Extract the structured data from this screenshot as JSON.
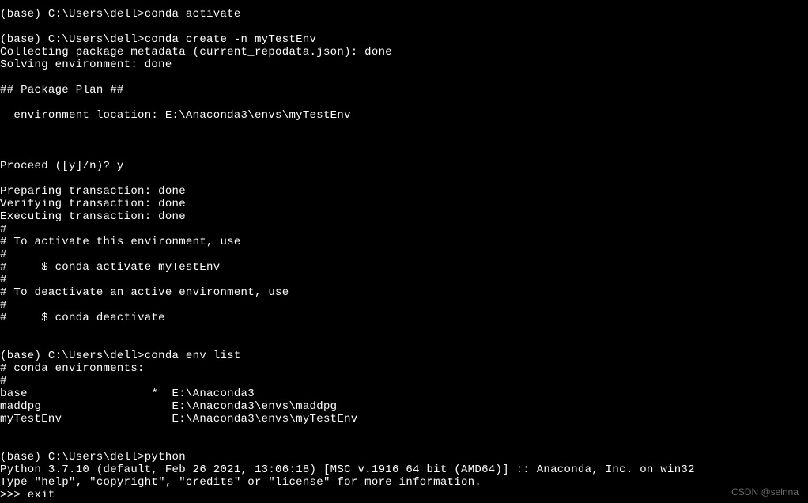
{
  "terminal": {
    "lines": [
      "(base) C:\\Users\\dell>conda activate",
      "",
      "(base) C:\\Users\\dell>conda create -n myTestEnv",
      "Collecting package metadata (current_repodata.json): done",
      "Solving environment: done",
      "",
      "## Package Plan ##",
      "",
      "  environment location: E:\\Anaconda3\\envs\\myTestEnv",
      "",
      "",
      "",
      "Proceed ([y]/n)? y",
      "",
      "Preparing transaction: done",
      "Verifying transaction: done",
      "Executing transaction: done",
      "#",
      "# To activate this environment, use",
      "#",
      "#     $ conda activate myTestEnv",
      "#",
      "# To deactivate an active environment, use",
      "#",
      "#     $ conda deactivate",
      "",
      "",
      "(base) C:\\Users\\dell>conda env list",
      "# conda environments:",
      "#",
      "base                  *  E:\\Anaconda3",
      "maddpg                   E:\\Anaconda3\\envs\\maddpg",
      "myTestEnv                E:\\Anaconda3\\envs\\myTestEnv",
      "",
      "",
      "(base) C:\\Users\\dell>python",
      "Python 3.7.10 (default, Feb 26 2021, 13:06:18) [MSC v.1916 64 bit (AMD64)] :: Anaconda, Inc. on win32",
      "Type \"help\", \"copyright\", \"credits\" or \"license\" for more information.",
      ">>> exit"
    ]
  },
  "watermark": "CSDN @selnna"
}
